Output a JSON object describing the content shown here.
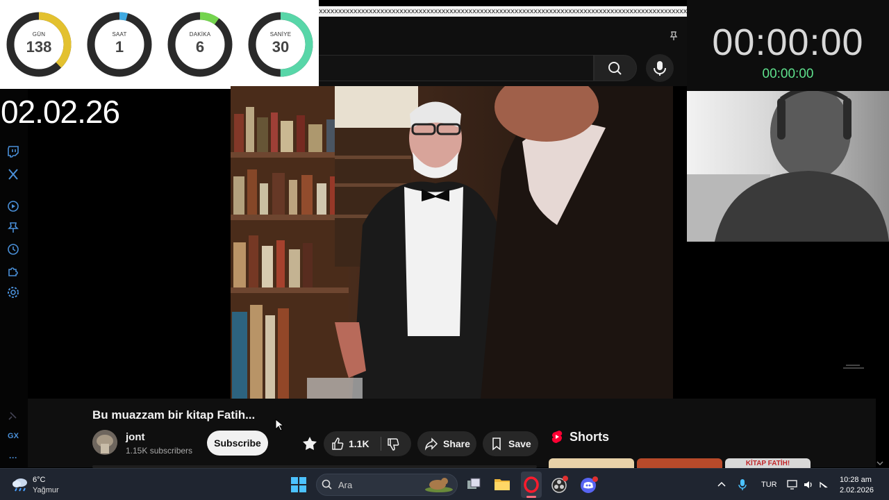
{
  "countdown": {
    "rings": [
      {
        "label": "GÜN",
        "value": "138",
        "color": "#e3c12f",
        "fraction": 0.378
      },
      {
        "label": "SAAT",
        "value": "1",
        "color": "#3fa9e0",
        "fraction": 0.042
      },
      {
        "label": "DAKİKA",
        "value": "6",
        "color": "#74d44e",
        "fraction": 0.1
      },
      {
        "label": "SANİYE",
        "value": "30",
        "color": "#58d6a8",
        "fraction": 0.5
      }
    ]
  },
  "ticker": {
    "text": "xxxxxxxxxxxxxxxxxxxxxxxxxxxxxxxxxxxxxxxxxxxxxxxxxxxxxxxxxxxxxxxxxxxxxxxxxxxxxxxxxxxxxxxxxxxxxxxxxx"
  },
  "overlay": {
    "date": "02.02.26"
  },
  "timer": {
    "big": "00:00:00",
    "small": "00:00:00"
  },
  "video": {
    "title": "Bu muazzam bir kitap Fatih...",
    "channel_name": "jont",
    "subscribers": "1.15K subscribers",
    "subscribe_label": "Subscribe",
    "like_count": "1.1K",
    "share_label": "Share",
    "save_label": "Save"
  },
  "shorts": {
    "title": "Shorts",
    "thumb_text": "KİTAP FATİH!"
  },
  "sidebar": {
    "gx_label": "GX",
    "more_label": "···"
  },
  "taskbar": {
    "weather_temp": "6°C",
    "weather_desc": "Yağmur",
    "search_placeholder": "Ara",
    "language": "TUR",
    "time": "10:28 am",
    "date": "2.02.2026"
  },
  "icons": [
    "twitch-icon",
    "x-icon",
    "play-circle-icon",
    "pin-icon",
    "history-icon",
    "extensions-icon",
    "settings-icon",
    "search-icon",
    "mic-icon",
    "like-icon",
    "dislike-icon",
    "share-icon",
    "save-icon",
    "shorts-icon",
    "windows-start-icon",
    "task-view-icon",
    "file-explorer-icon",
    "opera-icon",
    "obs-icon",
    "discord-icon"
  ]
}
